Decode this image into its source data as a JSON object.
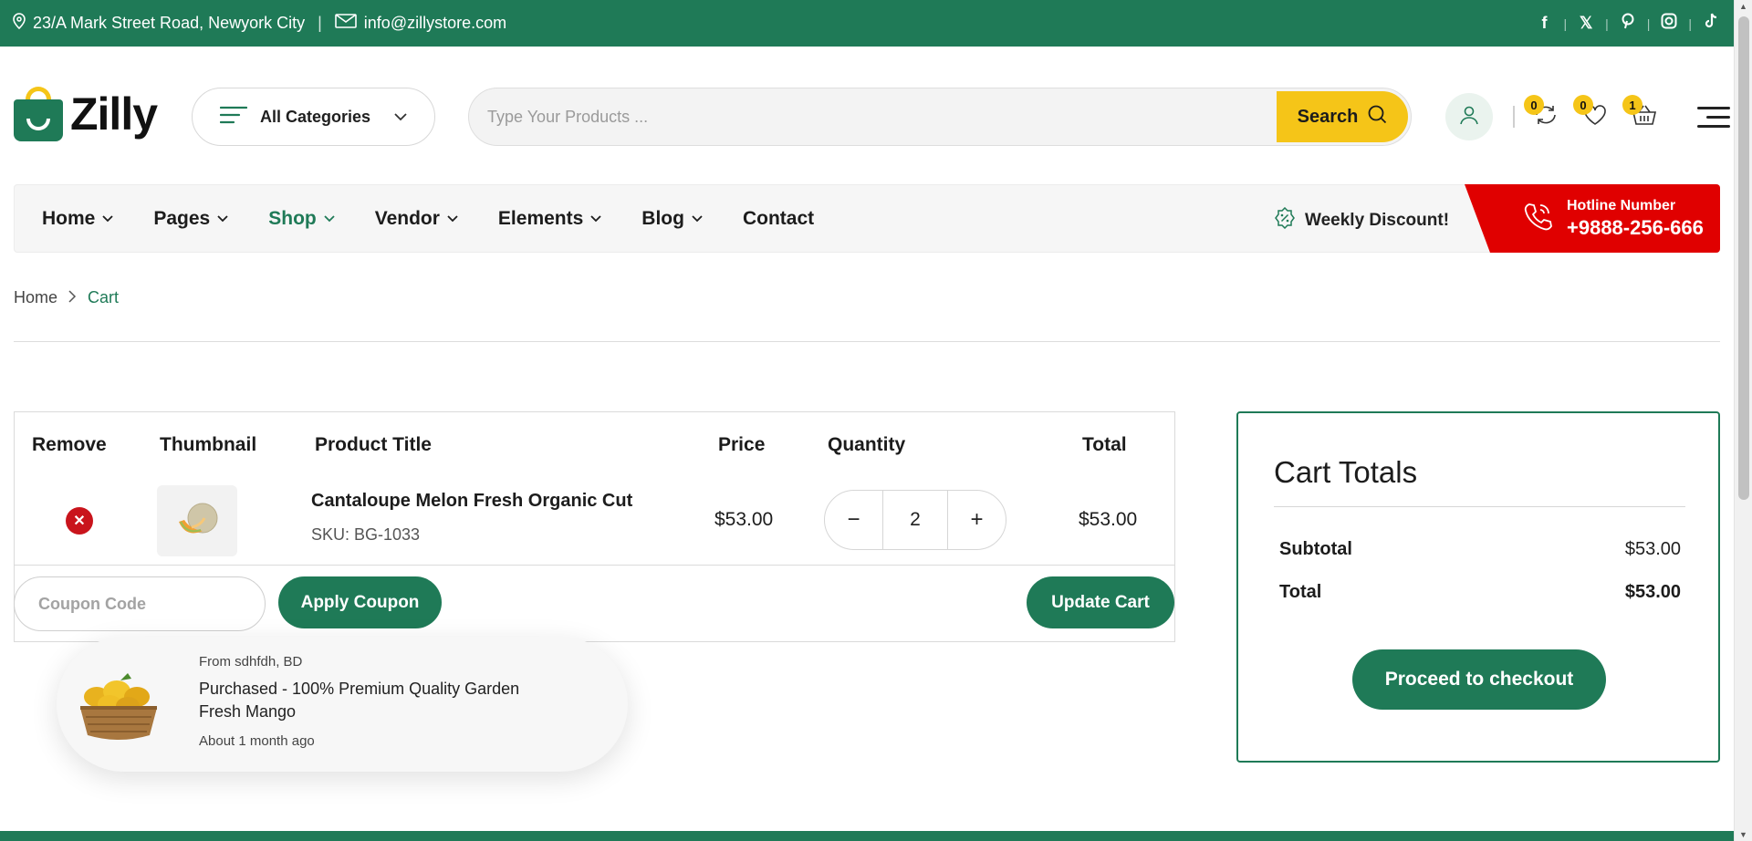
{
  "topbar": {
    "address": "23/A Mark Street Road, Newyork City",
    "separator": "|",
    "email": "info@zillystore.com",
    "socials": [
      "facebook-icon",
      "x-icon",
      "pinterest-icon",
      "instagram-icon",
      "tiktok-icon"
    ],
    "background": "#1f7a57"
  },
  "header": {
    "logo_text": "Zilly",
    "categories_label": "All Categories",
    "search_placeholder": "Type Your Products ...",
    "search_button": "Search",
    "compare_count": "0",
    "wishlist_count": "0",
    "cart_count": "1"
  },
  "nav": {
    "items": [
      {
        "label": "Home",
        "dropdown": true
      },
      {
        "label": "Pages",
        "dropdown": true
      },
      {
        "label": "Shop",
        "dropdown": true,
        "active": true
      },
      {
        "label": "Vendor",
        "dropdown": true
      },
      {
        "label": "Elements",
        "dropdown": true
      },
      {
        "label": "Blog",
        "dropdown": true
      },
      {
        "label": "Contact",
        "dropdown": false
      }
    ],
    "weekly_discount": "Weekly Discount!",
    "hotline_label": "Hotline Number",
    "hotline_number": "+9888-256-666"
  },
  "breadcrumb": {
    "home": "Home",
    "current": "Cart"
  },
  "cart": {
    "headers": {
      "remove": "Remove",
      "thumbnail": "Thumbnail",
      "title": "Product Title",
      "price": "Price",
      "quantity": "Quantity",
      "total": "Total"
    },
    "items": [
      {
        "title": "Cantaloupe Melon Fresh Organic Cut",
        "sku": "SKU: BG-1033",
        "price": "$53.00",
        "quantity": "2",
        "total": "$53.00"
      }
    ],
    "coupon_placeholder": "Coupon Code",
    "apply_coupon": "Apply Coupon",
    "update_cart": "Update Cart"
  },
  "totals": {
    "heading": "Cart Totals",
    "subtotal_label": "Subtotal",
    "subtotal_value": "$53.00",
    "total_label": "Total",
    "total_value": "$53.00",
    "checkout": "Proceed to checkout"
  },
  "popup": {
    "from": "From sdhfdh, BD",
    "title": "Purchased - 100% Premium Quality Garden Fresh Mango",
    "ago": "About 1 month ago"
  },
  "colors": {
    "brand_green": "#1f7a57",
    "accent_yellow": "#f5c518",
    "hotline_red": "#e00000",
    "remove_red": "#c9141c"
  }
}
